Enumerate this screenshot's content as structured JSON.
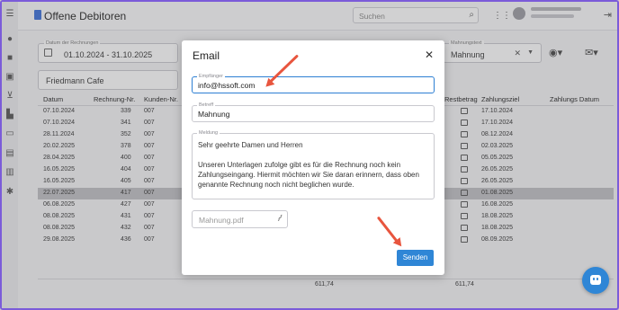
{
  "header": {
    "title": "Offene Debitoren",
    "search_placeholder": "Suchen"
  },
  "filters": {
    "date_label": "Datum der Rechnungen",
    "date_value": "01.10.2024 - 31.10.2025",
    "customer_value": "Friedmann Cafe",
    "mahnungstext_label": "Mahnungstext",
    "mahnungstext_value": "Mahnung"
  },
  "table": {
    "headers": [
      "Datum",
      "Rechnung-Nr.",
      "Kunden-Nr.",
      "Restbetrag",
      "Zahlungsziel",
      "Zahlungs Datum"
    ],
    "rows": [
      {
        "date": "07.10.2024",
        "nr": "339",
        "kunde": "007",
        "ziel": "17.10.2024"
      },
      {
        "date": "07.10.2024",
        "nr": "341",
        "kunde": "007",
        "ziel": "17.10.2024"
      },
      {
        "date": "28.11.2024",
        "nr": "352",
        "kunde": "007",
        "ziel": "08.12.2024"
      },
      {
        "date": "20.02.2025",
        "nr": "378",
        "kunde": "007",
        "ziel": "02.03.2025"
      },
      {
        "date": "28.04.2025",
        "nr": "400",
        "kunde": "007",
        "ziel": "05.05.2025"
      },
      {
        "date": "16.05.2025",
        "nr": "404",
        "kunde": "007",
        "ziel": "26.05.2025"
      },
      {
        "date": "16.05.2025",
        "nr": "405",
        "kunde": "007",
        "ziel": "26.05.2025"
      },
      {
        "date": "22.07.2025",
        "nr": "417",
        "kunde": "007",
        "ziel": "01.08.2025"
      },
      {
        "date": "06.08.2025",
        "nr": "427",
        "kunde": "007",
        "ziel": "16.08.2025"
      },
      {
        "date": "08.08.2025",
        "nr": "431",
        "kunde": "007",
        "ziel": "18.08.2025"
      },
      {
        "date": "08.08.2025",
        "nr": "432",
        "kunde": "007",
        "ziel": "18.08.2025"
      },
      {
        "date": "29.08.2025",
        "nr": "436",
        "kunde": "007",
        "ziel": "08.09.2025"
      }
    ],
    "total_left": "611,74",
    "total_right": "611,74"
  },
  "modal": {
    "title": "Email",
    "recipient_label": "Empfänger",
    "recipient_value": "info@hssoft.com",
    "subject_label": "Betreff",
    "subject_value": "Mahnung",
    "message_label": "Meldung",
    "message_greeting": "Sehr geehrte Damen und Herren",
    "message_body": "Unseren Unterlagen zufolge gibt es für die Rechnung noch kein Zahlungseingang. Hiermit möchten wir Sie daran erinnern, dass oben genannte Rechnung noch nicht beglichen wurde.",
    "attachment": "Mahnung.pdf",
    "send_label": "Senden"
  },
  "colors": {
    "accent": "#2f86d6",
    "arrow": "#e8553e",
    "frame": "#7b5bd9"
  }
}
